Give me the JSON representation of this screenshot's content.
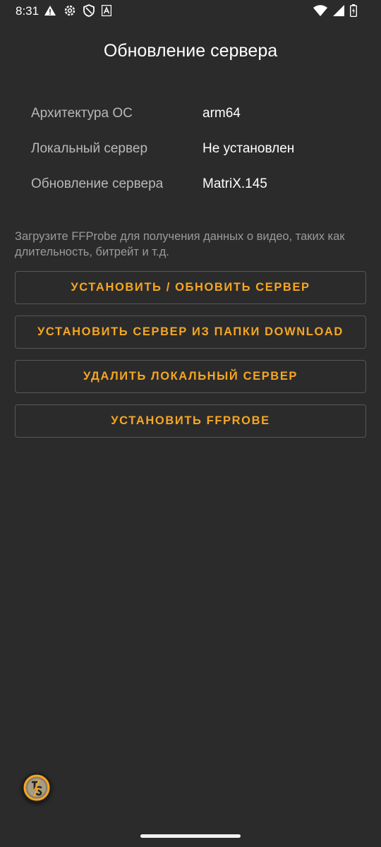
{
  "status_bar": {
    "time": "8:31",
    "left_icons": [
      "warning-icon",
      "gear-icon",
      "shield-icon",
      "font-icon"
    ],
    "right_icons": [
      "wifi-icon",
      "signal-icon",
      "battery-icon"
    ]
  },
  "title": "Обновление сервера",
  "info": [
    {
      "label": "Архитектура ОС",
      "value": "arm64"
    },
    {
      "label": "Локальный сервер",
      "value": "Не установлен"
    },
    {
      "label": "Обновление сервера",
      "value": "MatriX.145"
    }
  ],
  "description": "Загрузите FFProbe для получения данных о видео, таких как длительность, битрейт и т.д.",
  "buttons": [
    {
      "label": "УСТАНОВИТЬ / ОБНОВИТЬ СЕРВЕР"
    },
    {
      "label": "УСТАНОВИТЬ СЕРВЕР ИЗ ПАПКИ DOWNLOAD"
    },
    {
      "label": "УДАЛИТЬ ЛОКАЛЬНЫЙ СЕРВЕР"
    },
    {
      "label": "УСТАНОВИТЬ FFPROBE"
    }
  ],
  "colors": {
    "background": "#2b2b2b",
    "accent": "#f5a623",
    "label": "#b8b8b8",
    "muted": "#9a9a9a"
  },
  "floating_icon": "torrserve-logo-icon"
}
